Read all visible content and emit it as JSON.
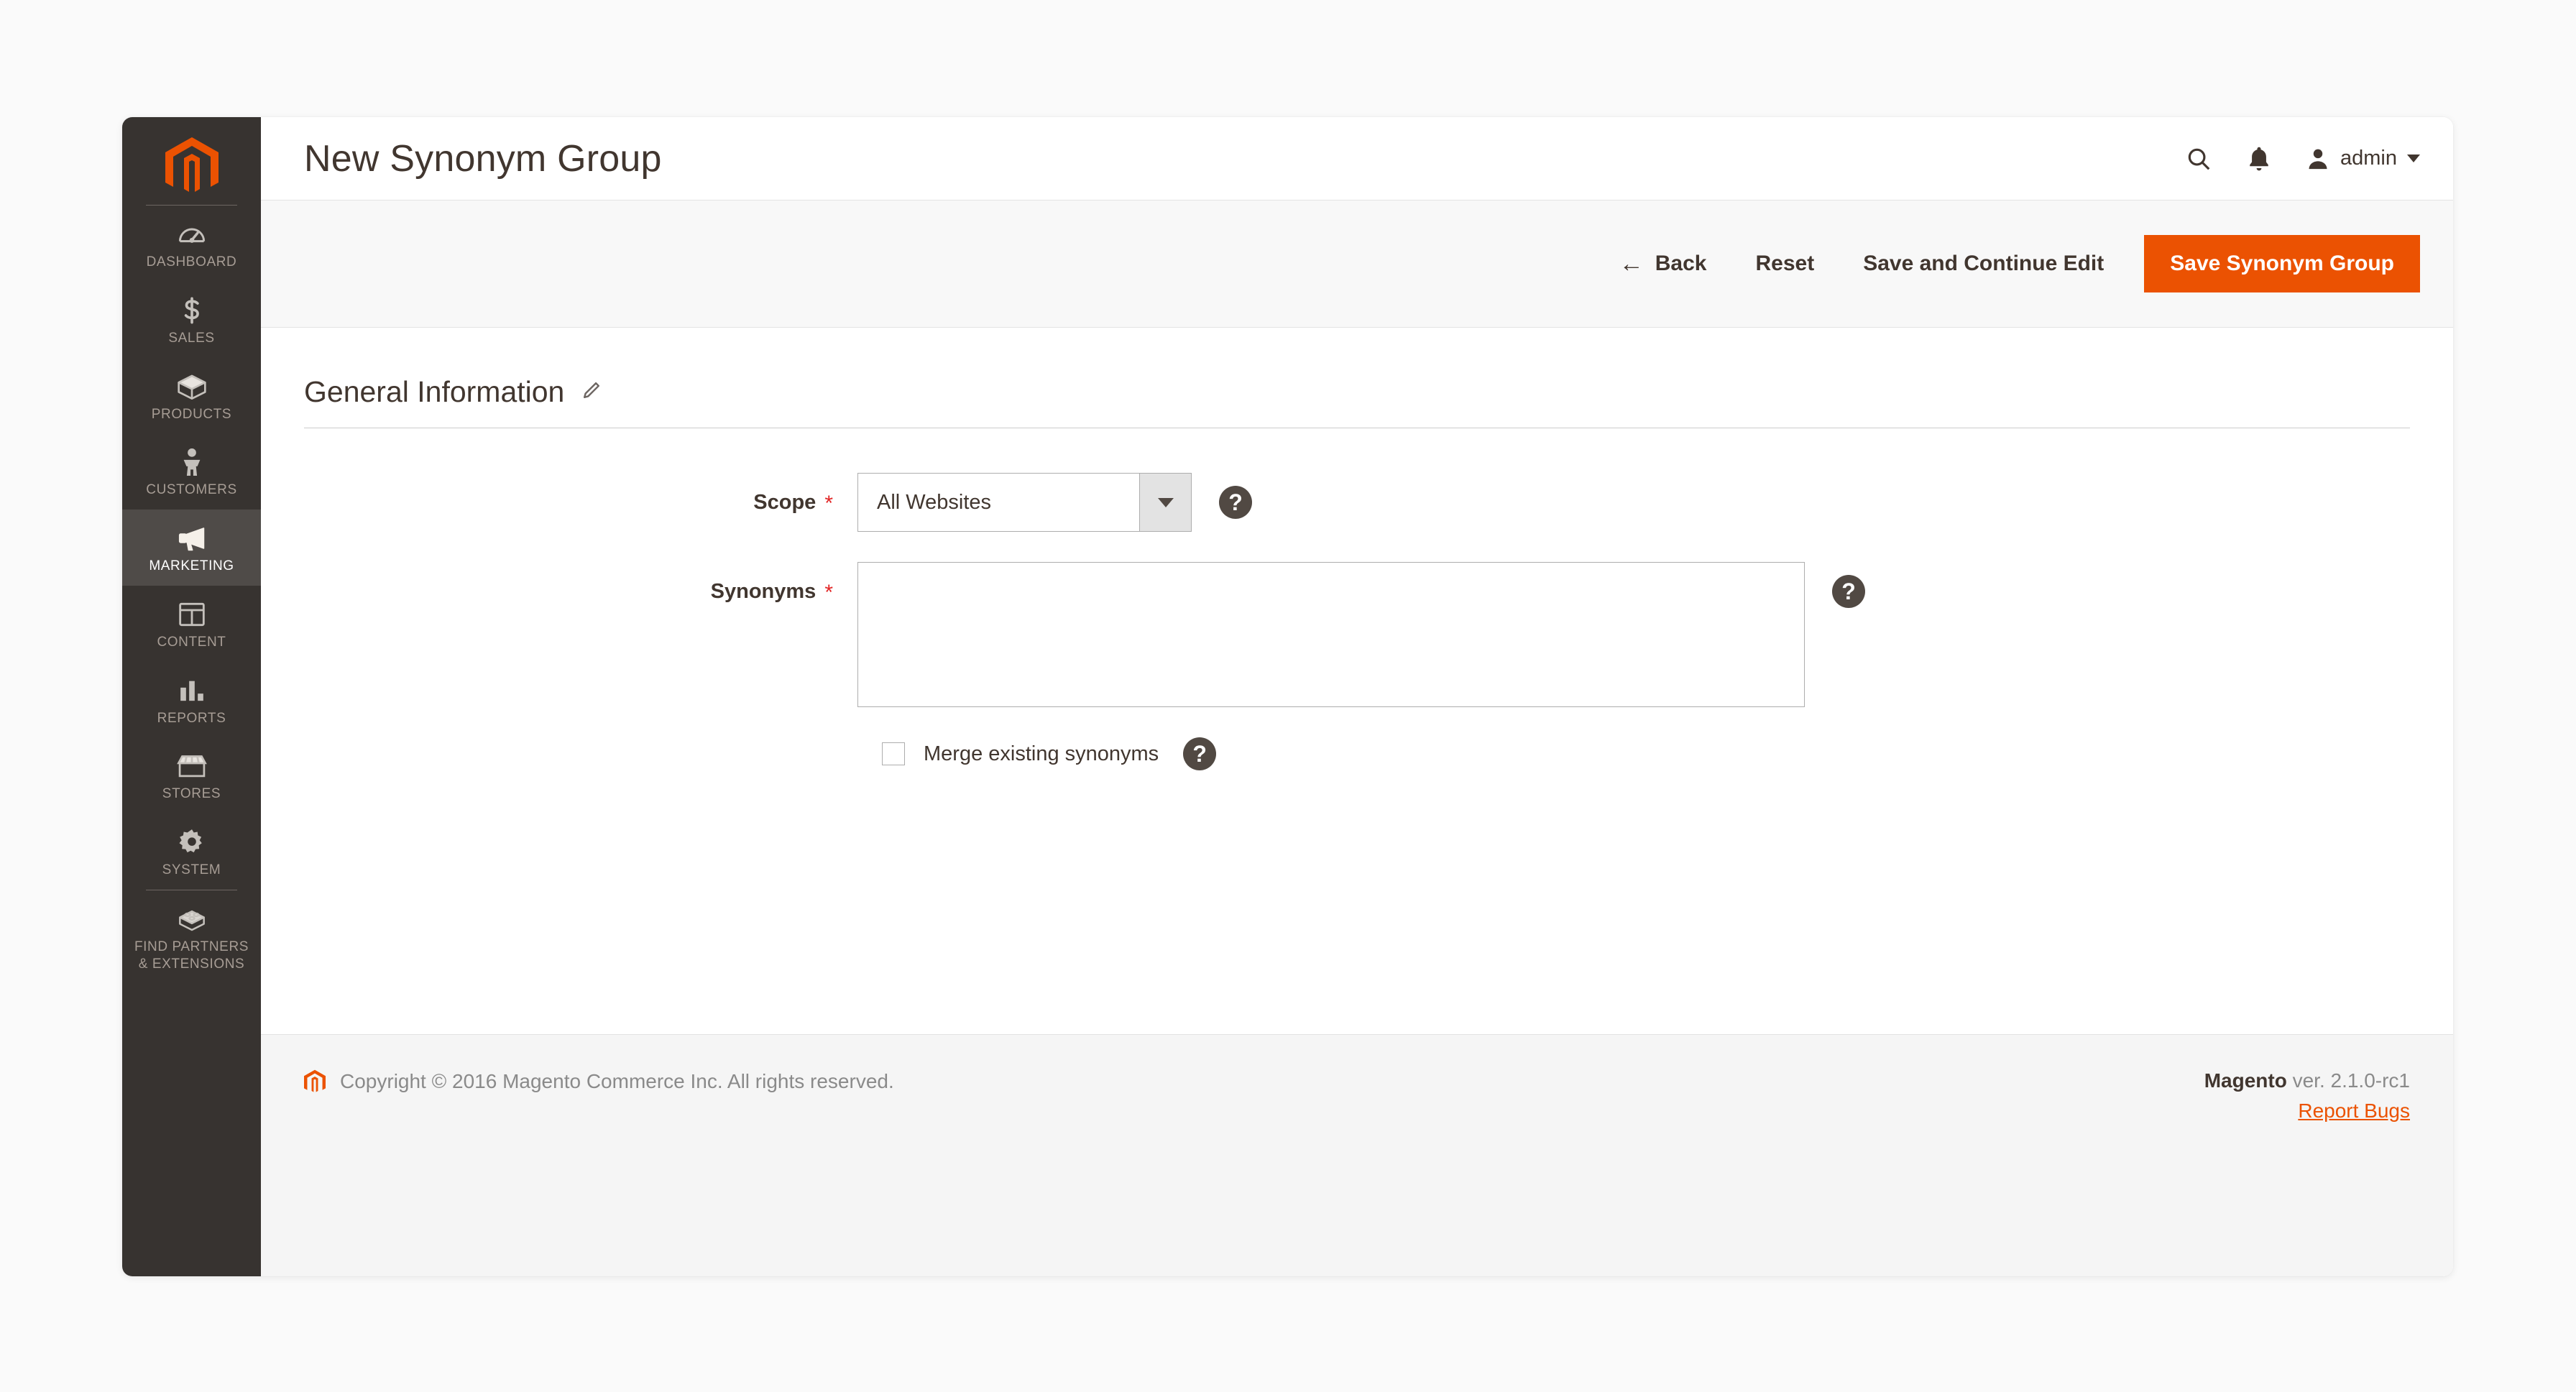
{
  "sidebar": {
    "logo_icon": "magento-logo-icon",
    "items": [
      {
        "label": "DASHBOARD",
        "icon": "dashboard-gauge-icon",
        "active": false,
        "divider_before": true
      },
      {
        "label": "SALES",
        "icon": "dollar-sign-icon",
        "active": false,
        "divider_before": false
      },
      {
        "label": "PRODUCTS",
        "icon": "box-icon",
        "active": false,
        "divider_before": false
      },
      {
        "label": "CUSTOMERS",
        "icon": "person-icon",
        "active": false,
        "divider_before": false
      },
      {
        "label": "MARKETING",
        "icon": "megaphone-icon",
        "active": true,
        "divider_before": false
      },
      {
        "label": "CONTENT",
        "icon": "layout-icon",
        "active": false,
        "divider_before": false
      },
      {
        "label": "REPORTS",
        "icon": "bar-chart-icon",
        "active": false,
        "divider_before": false
      },
      {
        "label": "STORES",
        "icon": "storefront-icon",
        "active": false,
        "divider_before": false
      },
      {
        "label": "SYSTEM",
        "icon": "gear-icon",
        "active": false,
        "divider_before": false
      },
      {
        "label": "FIND PARTNERS\n& EXTENSIONS",
        "icon": "lego-brick-icon",
        "active": false,
        "divider_before": true
      }
    ]
  },
  "header": {
    "title": "New Synonym Group",
    "search_icon": "search-icon",
    "notifications_icon": "bell-icon",
    "avatar_icon": "user-avatar-icon",
    "admin_name": "admin",
    "caret_icon": "chevron-down-icon"
  },
  "toolbar": {
    "back_arrow": "←",
    "back_label": "Back",
    "reset_label": "Reset",
    "save_continue_label": "Save and Continue Edit",
    "save_label": "Save Synonym Group",
    "primary_color": "#eb5202"
  },
  "section": {
    "title": "General Information",
    "edit_icon": "pencil-icon"
  },
  "form": {
    "scope": {
      "label": "Scope",
      "required_marker": "*",
      "value": "All Websites",
      "options": [
        "All Websites"
      ],
      "help_icon": "question-mark-icon"
    },
    "synonyms": {
      "label": "Synonyms",
      "required_marker": "*",
      "value": "",
      "placeholder": "",
      "help_icon": "question-mark-icon"
    },
    "merge": {
      "label": "Merge existing synonyms",
      "checked": false,
      "help_icon": "question-mark-icon"
    }
  },
  "footer": {
    "logo_icon": "magento-logo-small-icon",
    "copyright": "Copyright © 2016 Magento Commerce Inc. All rights reserved.",
    "brand": "Magento",
    "version": " ver. 2.1.0-rc1",
    "report_bugs": "Report Bugs"
  }
}
